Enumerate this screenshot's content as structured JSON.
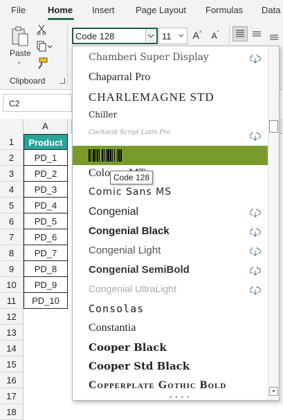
{
  "tabs": [
    {
      "label": "File"
    },
    {
      "label": "Home"
    },
    {
      "label": "Insert"
    },
    {
      "label": "Page Layout"
    },
    {
      "label": "Formulas"
    },
    {
      "label": "Data"
    }
  ],
  "ribbon": {
    "paste_label": "Paste",
    "clipboard_label": "Clipboard",
    "font_name": "Code 128",
    "font_size": "11"
  },
  "name_box": "C2",
  "grid": {
    "column_a": "A",
    "rows": [
      "1",
      "2",
      "3",
      "4",
      "5",
      "6",
      "7",
      "8",
      "9",
      "10",
      "11",
      "12",
      "13",
      "14",
      "15",
      "16",
      "17",
      "18"
    ],
    "header_cell": "Product",
    "cells": [
      "PD_1",
      "PD_2",
      "PD_3",
      "PD_4",
      "PD_5",
      "PD_6",
      "PD_7",
      "PD_8",
      "PD_9",
      "PD_10"
    ]
  },
  "fonts": [
    {
      "name": "Chamberi Super Display",
      "cloud": true
    },
    {
      "name": "Chaparral Pro",
      "cloud": false
    },
    {
      "name": "CHARLEMAGNE STD",
      "cloud": false
    },
    {
      "name": "Chiller",
      "cloud": false
    },
    {
      "name": "Cochocib Script Latin Pro",
      "cloud": true
    },
    {
      "name": "Code 128",
      "cloud": false
    },
    {
      "name": "Colonna MT",
      "cloud": false
    },
    {
      "name": "Comic Sans MS",
      "cloud": false
    },
    {
      "name": "Congenial",
      "cloud": true
    },
    {
      "name": "Congenial Black",
      "cloud": true
    },
    {
      "name": "Congenial Light",
      "cloud": true
    },
    {
      "name": "Congenial SemiBold",
      "cloud": true
    },
    {
      "name": "Congenial UltraLight",
      "cloud": true
    },
    {
      "name": "Consolas",
      "cloud": false
    },
    {
      "name": "Constantia",
      "cloud": false
    },
    {
      "name": "Cooper Black",
      "cloud": false
    },
    {
      "name": "Cooper Std Black",
      "cloud": false
    },
    {
      "name": "Copperplate Gothic Bold",
      "cloud": false
    }
  ],
  "tooltip": "Code 128",
  "colors": {
    "accent": "#217346",
    "selected": "#7a9b2c",
    "header": "#2aa39a"
  }
}
